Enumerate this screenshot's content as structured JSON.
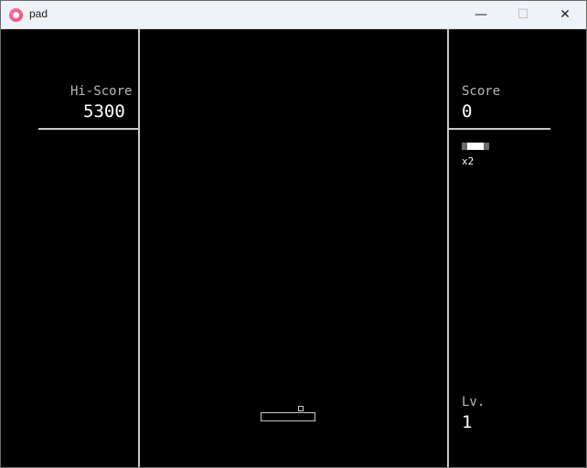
{
  "window": {
    "title": "pad",
    "minimize_glyph": "—",
    "maximize_glyph": "☐",
    "close_glyph": "✕"
  },
  "hud": {
    "hiscore_label": "Hi-Score",
    "hiscore_value": "5300",
    "score_label": "Score",
    "score_value": "0",
    "multiplier": "x2",
    "level_label": "Lv.",
    "level_value": "1"
  },
  "colors": {
    "background": "#000000",
    "lines": "#c9c9c9",
    "titlebar": "#eef3f7",
    "app_icon": "#ff5a8a"
  }
}
